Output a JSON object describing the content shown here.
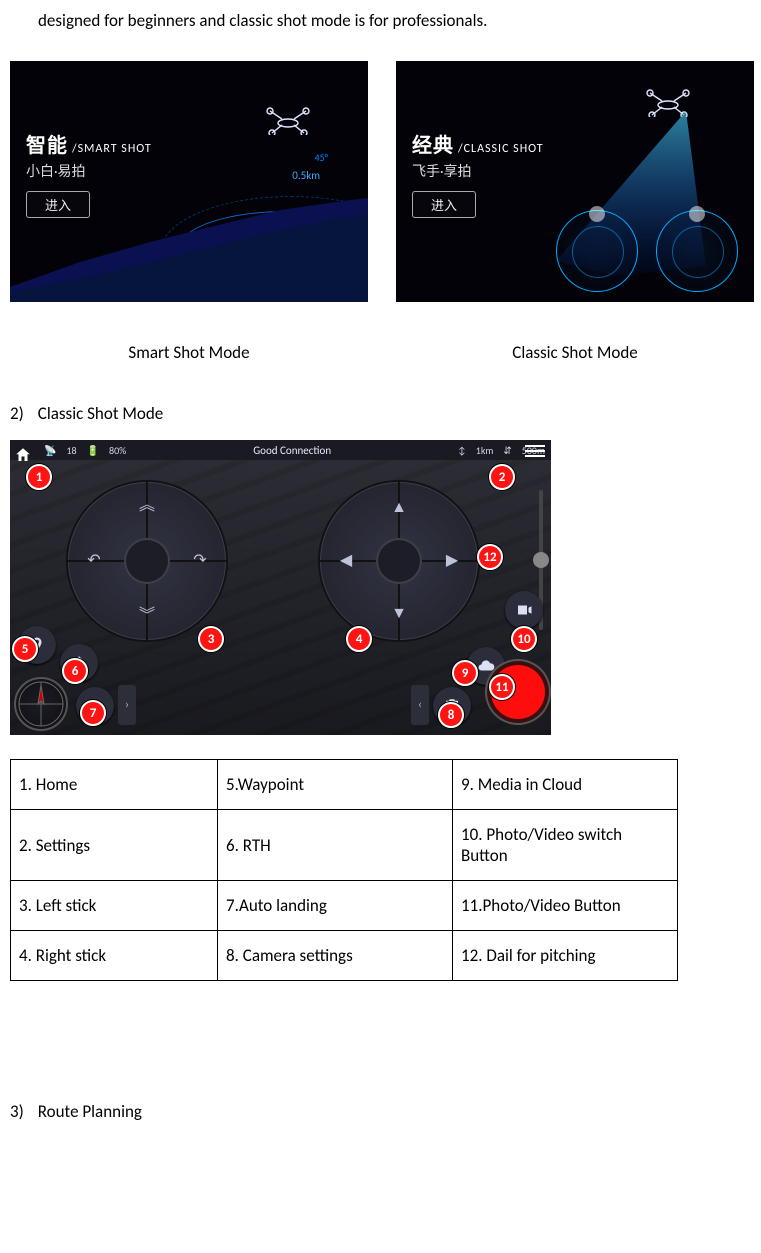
{
  "intro": "designed for beginners and classic shot mode is for professionals.",
  "smart": {
    "title_zh": "智能",
    "title_en": "/SMART SHOT",
    "sub": "小白·易拍",
    "btn": "进入",
    "alt": "45°",
    "dist": "0.5km",
    "caption": "Smart Shot Mode"
  },
  "classic": {
    "title_zh": "经典",
    "title_en": "/CLASSIC SHOT",
    "sub": "飞手·享拍",
    "btn": "进入",
    "caption": "Classic Shot Mode"
  },
  "section2": {
    "num": "2)",
    "title": "Classic Shot Mode"
  },
  "topbar": {
    "sat": "18",
    "batt": "80%",
    "status": "Good Connection",
    "dist": "1km",
    "alt": "500m"
  },
  "callouts": [
    "1",
    "2",
    "3",
    "4",
    "5",
    "6",
    "7",
    "8",
    "9",
    "10",
    "11",
    "12"
  ],
  "legend": [
    [
      "1. Home",
      "5.Waypoint",
      "9. Media in Cloud"
    ],
    [
      "2. Settings",
      "6. RTH",
      "10. Photo/Video switch Button"
    ],
    [
      "3. Left stick",
      "7.Auto landing",
      "11.Photo/Video Button"
    ],
    [
      "4. Right stick",
      "8. Camera settings",
      "12. Dail for pitching"
    ]
  ],
  "section3": {
    "num": "3)",
    "title": "Route Planning"
  }
}
